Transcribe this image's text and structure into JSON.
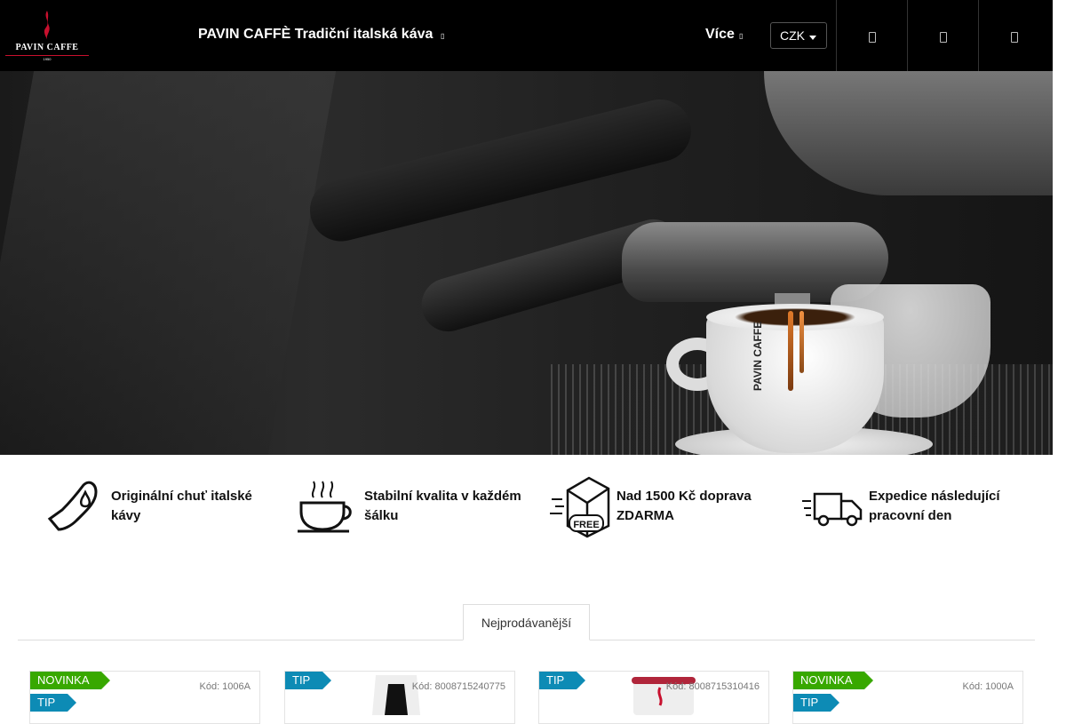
{
  "header": {
    "logo_text": "PAVIN CAFFE",
    "logo_year": "1950",
    "title": "PAVIN CAFFÈ Tradiční italská káva",
    "more_label": "Více",
    "currency": "CZK",
    "icons": [
      "search-icon",
      "user-icon",
      "cart-icon"
    ]
  },
  "hero": {
    "cup_brand": "PAVIN CAFFE"
  },
  "features": [
    {
      "icon": "hand-drop-icon",
      "text": "Originální chuť italské kávy"
    },
    {
      "icon": "coffee-cup-icon",
      "text": "Stabilní kvalita v každém šálku"
    },
    {
      "icon": "free-shipping-box-icon",
      "text": "Nad 1500 Kč doprava ZDARMA"
    },
    {
      "icon": "delivery-truck-icon",
      "text": "Expedice následující pracovní den"
    }
  ],
  "tabs": {
    "active": "Nejprodávanější"
  },
  "products": [
    {
      "flags": [
        "NOVINKA",
        "TIP"
      ],
      "code": "Kód: 1006A"
    },
    {
      "flags": [
        "TIP"
      ],
      "code": "Kód: 8008715240775"
    },
    {
      "flags": [
        "TIP"
      ],
      "code": "Kód: 8008715310416"
    },
    {
      "flags": [
        "NOVINKA",
        "TIP"
      ],
      "code": "Kód: 1000A"
    }
  ],
  "colors": {
    "header_bg": "#000000",
    "brand_red": "#c8102e",
    "flag_new": "#38a800",
    "flag_tip": "#0d8bb5"
  }
}
